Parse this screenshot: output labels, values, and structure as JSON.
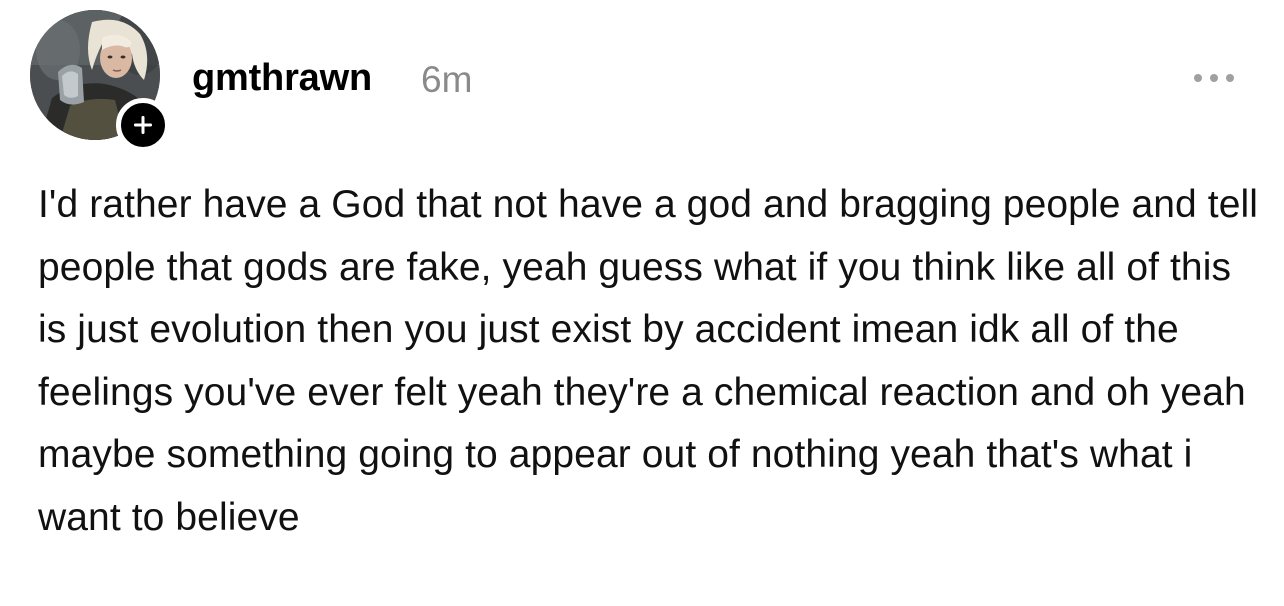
{
  "post": {
    "author": {
      "username": "gmthrawn",
      "avatar_icon": "profile-photo",
      "follow_icon": "plus-icon"
    },
    "timestamp": "6m",
    "more_icon": "ellipsis-icon",
    "body": "I'd rather have a God that not have a god and bragging people and tell people that gods are fake, yeah guess what if you think like all of this is just evolution then you just exist by accident imean idk all of the feelings you've ever felt yeah they're a chemical reaction and oh yeah maybe something going to appear out of nothing yeah that's what i want to believe"
  },
  "colors": {
    "text": "#111111",
    "timestamp": "#8a8a8a",
    "more_dots": "#a0a0a0",
    "badge": "#000000",
    "background": "#ffffff"
  }
}
